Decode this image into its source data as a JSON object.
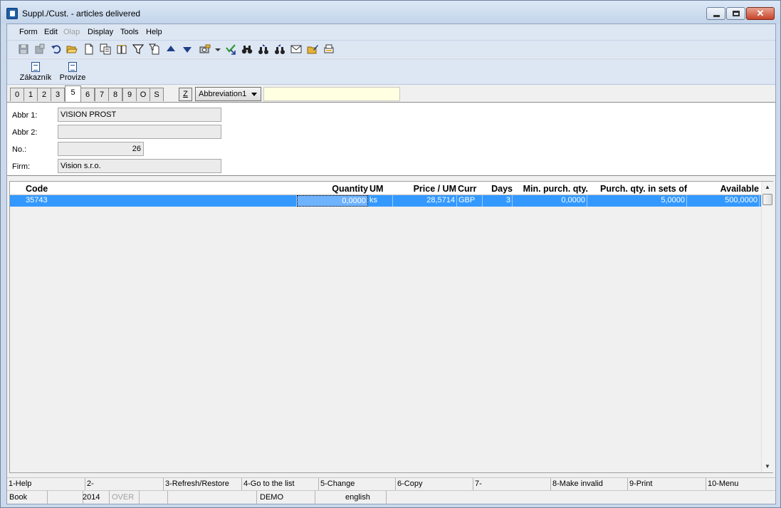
{
  "window": {
    "title": "Suppl./Cust. - articles delivered"
  },
  "menu": [
    "Form",
    "Edit",
    "Olap",
    "Display",
    "Tools",
    "Help"
  ],
  "custom_toolbar": [
    "Zákazník",
    "Provize"
  ],
  "tabs": [
    "0",
    "1",
    "2",
    "3",
    "5",
    "6",
    "7",
    "8",
    "9",
    "O",
    "S"
  ],
  "active_tab": "5",
  "sort": {
    "button": "Z",
    "selected": "Abbreviation1",
    "search_value": ""
  },
  "form": {
    "abbr1_label": "Abbr 1:",
    "abbr1_value": "VISION PROST",
    "abbr2_label": "Abbr 2:",
    "abbr2_value": "",
    "no_label": "No.:",
    "no_value": "26",
    "firm_label": "Firm:",
    "firm_value": "Vision s.r.o."
  },
  "grid": {
    "columns": [
      "Code",
      "Quantity",
      "UM",
      "Price / UM",
      "Curr",
      "Days",
      "Min. purch. qty.",
      "Purch. qty. in sets of",
      "Available"
    ],
    "rows": [
      {
        "code": "35743",
        "quantity": "0,0000",
        "um": "ks",
        "price": "28,5714",
        "curr": "GBP",
        "days": "3",
        "min_qty": "0,0000",
        "sets_of": "5,0000",
        "available": "500,0000"
      }
    ]
  },
  "fkeys": [
    "1-Help",
    "2-",
    "3-Refresh/Restore",
    "4-Go to the list",
    "5-Change",
    "6-Copy",
    "7-",
    "8-Make invalid",
    "9-Print",
    "10-Menu"
  ],
  "status": {
    "book": "Book",
    "year": "2014",
    "mode": "OVER",
    "blank1": "",
    "blank2": "",
    "db": "DEMO",
    "language": "english"
  },
  "icons": [
    "save-icon",
    "save-disabled-icon",
    "undo-icon",
    "open-folder-icon",
    "new-document-icon",
    "copy-icon",
    "book-icon",
    "filter-icon",
    "filter-document-icon",
    "up-arrow-icon",
    "down-arrow-icon",
    "camera-icon",
    "dropdown-icon",
    "check-arrow-icon",
    "binoculars-icon",
    "binoculars-next-icon",
    "binoculars-prev-icon",
    "mail-icon",
    "edit-folder-icon",
    "print-list-icon"
  ]
}
